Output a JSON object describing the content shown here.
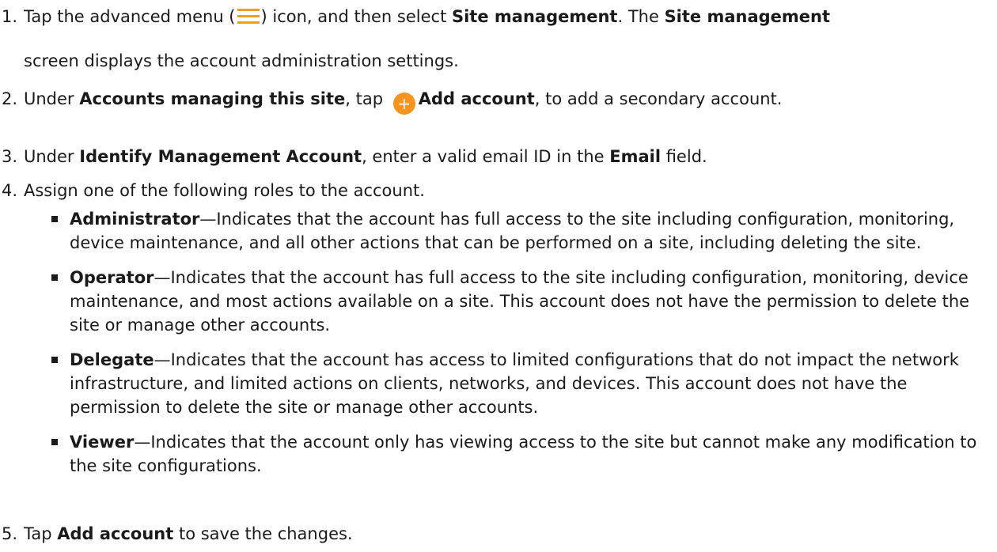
{
  "steps": [
    {
      "num": "1.",
      "t1": "Tap the advanced menu (",
      "t2": ") icon, and then select ",
      "b1": "Site management",
      "t3": ". The ",
      "b2": "Site management",
      "t4": "screen displays the account administration settings.",
      "icon": "menu-icon"
    },
    {
      "num": "2.",
      "t1": "Under ",
      "b1": "Accounts managing this site",
      "t2": ", tap ",
      "b2": "Add account",
      "t3": ", to add a secondary account.",
      "icon": "add-icon",
      "icon_glyph": "+"
    },
    {
      "num": "3.",
      "t1": "Under ",
      "b1": "Identify Management Account",
      "t2": ", enter a valid email ID in the ",
      "b2": "Email",
      "t3": " field."
    },
    {
      "num": "4.",
      "t1": "Assign one of the following roles to the account."
    },
    {
      "num": "5.",
      "t1": "Tap ",
      "b1": "Add account",
      "t2": " to save the changes."
    }
  ],
  "roles": [
    {
      "name": "Administrator",
      "desc": "—Indicates that the account has full access to the site including configuration, monitoring, device maintenance, and all other actions that can be performed on a site, including deleting the site."
    },
    {
      "name": "Operator",
      "desc": "—Indicates that the account has full access to the site including configuration, monitoring, device maintenance, and most actions available on a site. This account does not have the permission to delete the site or manage other accounts."
    },
    {
      "name": "Delegate",
      "desc": "—Indicates that the account has access to limited configurations that do not impact the network infrastructure, and limited actions on clients, networks, and devices. This account does not have the permission to delete the site or manage other accounts."
    },
    {
      "name": "Viewer",
      "desc": "—Indicates that the account only has viewing access to the site but cannot make any modification to the site configurations."
    }
  ],
  "colors": {
    "accent": "#f7941d",
    "text": "#1a1a1a"
  }
}
